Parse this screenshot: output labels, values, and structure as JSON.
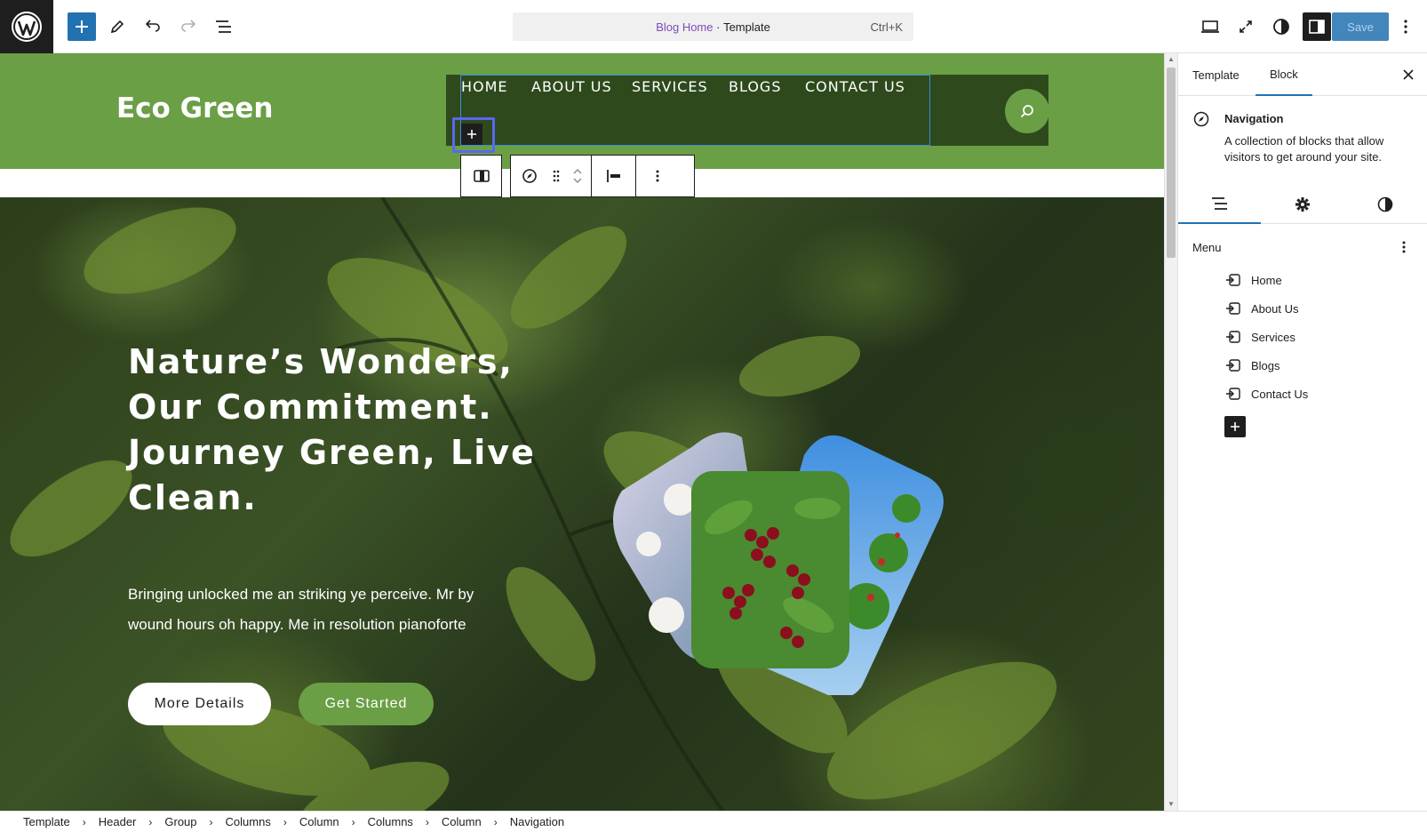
{
  "topbar": {
    "command_bar": {
      "template_name": "Blog Home",
      "separator": " · ",
      "template_type": "Template",
      "shortcut": "Ctrl+K"
    },
    "save_label": "Save"
  },
  "site": {
    "title": "Eco Green",
    "nav": [
      "HOME",
      "ABOUT US",
      "SERVICES",
      "BLOGS",
      "CONTACT US"
    ]
  },
  "hero": {
    "heading_lines": [
      "Nature’s Wonders,",
      "Our Commitment.",
      "Journey Green, Live",
      "Clean."
    ],
    "text_lines": [
      "Bringing unlocked me an striking ye perceive. Mr by",
      "wound hours oh happy. Me in resolution pianoforte"
    ],
    "btn_more": "More Details",
    "btn_start": "Get Started"
  },
  "breadcrumbs": [
    "Template",
    "Header",
    "Group",
    "Columns",
    "Column",
    "Columns",
    "Column",
    "Navigation"
  ],
  "sidebar": {
    "tabs": [
      "Template",
      "Block"
    ],
    "block_title": "Navigation",
    "block_desc": "A collection of blocks that allow visitors to get around your site.",
    "menu_title": "Menu",
    "menu_items": [
      "Home",
      "About Us",
      "Services",
      "Blogs",
      "Contact Us"
    ]
  },
  "colors": {
    "header_green": "#6a9f45",
    "nav_dark": "#2e4a1c",
    "accent_blue": "#2271b1",
    "template_purple": "#7e4bb5"
  }
}
